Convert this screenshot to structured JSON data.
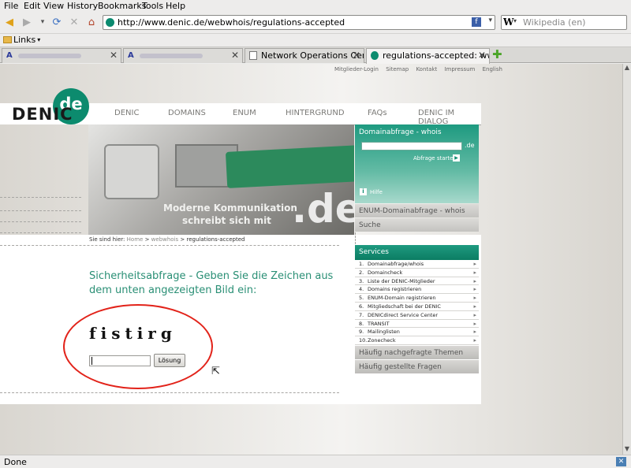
{
  "browser": {
    "menu": [
      "File",
      "Edit",
      "View",
      "History",
      "Bookmarks",
      "Tools",
      "Help"
    ],
    "url": "http://www.denic.de/webwhois/regulations-accepted",
    "search_placeholder": "Wikipedia (en)",
    "search_engine_letter": "W",
    "bookmarks_folder": "Links",
    "tabs": [
      {
        "title": "",
        "blurred": true,
        "active": false
      },
      {
        "title": "",
        "blurred": true,
        "active": false
      },
      {
        "title": "Network Operations Centre",
        "blurred": false,
        "active": false
      },
      {
        "title": "regulations-accepted: www....",
        "blurred": false,
        "active": true
      }
    ],
    "status": "Done"
  },
  "site": {
    "top_links": [
      "Mitglieder-Login",
      "Sitemap",
      "Kontakt",
      "Impressum",
      "English"
    ],
    "logo_word": "DENIC",
    "logo_badge": "de",
    "nav": [
      "DENIC",
      "DOMAINS",
      "ENUM",
      "HINTERGRUND",
      "FAQs",
      "DENIC IM DIALOG"
    ],
    "hero_tagline_1": "Moderne Kommunikation",
    "hero_tagline_2": "schreibt sich mit",
    "hero_brand": ".de",
    "whois": {
      "title": "Domainabfrage - whois",
      "suffix": ".de",
      "submit": "Abfrage starten",
      "help_icon_letter": "i",
      "help": "Hilfe"
    },
    "enum_box": "ENUM-Domainabfrage - whois",
    "suche_box": "Suche",
    "breadcrumb_prefix": "Sie sind hier:",
    "breadcrumb": [
      "Home",
      "webwhois",
      "regulations-accepted"
    ],
    "breadcrumb_sep": ">",
    "heading": "Sicherheitsabfrage - Geben Sie die Zeichen aus dem unten angezeigten Bild ein:",
    "captcha_text": "fistirg",
    "captcha_value": "",
    "captcha_button": "Lösung",
    "services_title": "Services",
    "services": [
      {
        "num": "1.",
        "label": "Domainabfrage/whois"
      },
      {
        "num": "2.",
        "label": "Domaincheck"
      },
      {
        "num": "3.",
        "label": "Liste der DENIC-Mitglieder"
      },
      {
        "num": "4.",
        "label": "Domains registrieren"
      },
      {
        "num": "5.",
        "label": "ENUM-Domain registrieren"
      },
      {
        "num": "6.",
        "label": "Mitgliedschaft bei der DENIC"
      },
      {
        "num": "7.",
        "label": "DENICdirect Service Center"
      },
      {
        "num": "8.",
        "label": "TRANSIT"
      },
      {
        "num": "9.",
        "label": "Mailinglisten"
      },
      {
        "num": "10.",
        "label": "Zonecheck"
      }
    ],
    "faq_themes": "Häufig nachgefragte Themen",
    "faq_questions": "Häufig gestellte Fragen"
  },
  "colors": {
    "brand_green": "#0c8b6e",
    "annotation_red": "#e2231a"
  }
}
